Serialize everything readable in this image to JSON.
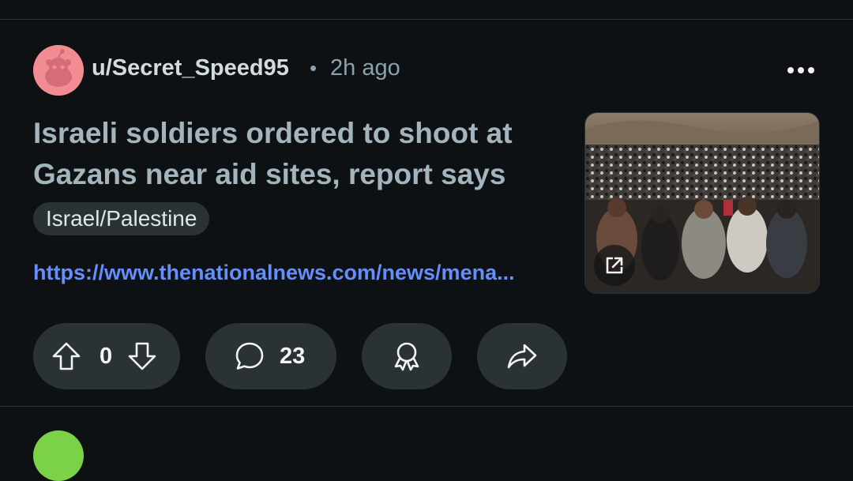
{
  "post": {
    "username": "u/Secret_Speed95",
    "separator": "•",
    "time": "2h ago",
    "title": "Israeli soldiers ordered to shoot at Gazans near aid sites, report says",
    "flair": "Israel/Palestine",
    "link": "https://www.thenationalnews.com/news/mena...",
    "votes": "0",
    "comments": "23"
  },
  "icons": {
    "more": "more-options-icon",
    "external": "external-link-icon",
    "upvote": "upvote-arrow-icon",
    "downvote": "downvote-arrow-icon",
    "comment": "comment-bubble-icon",
    "award": "award-icon",
    "share": "share-arrow-icon"
  },
  "colors": {
    "background": "#0e1113",
    "pill": "#2a3236",
    "link": "#648efc",
    "title": "#a4b4bd",
    "avatar": "#f28c93"
  }
}
